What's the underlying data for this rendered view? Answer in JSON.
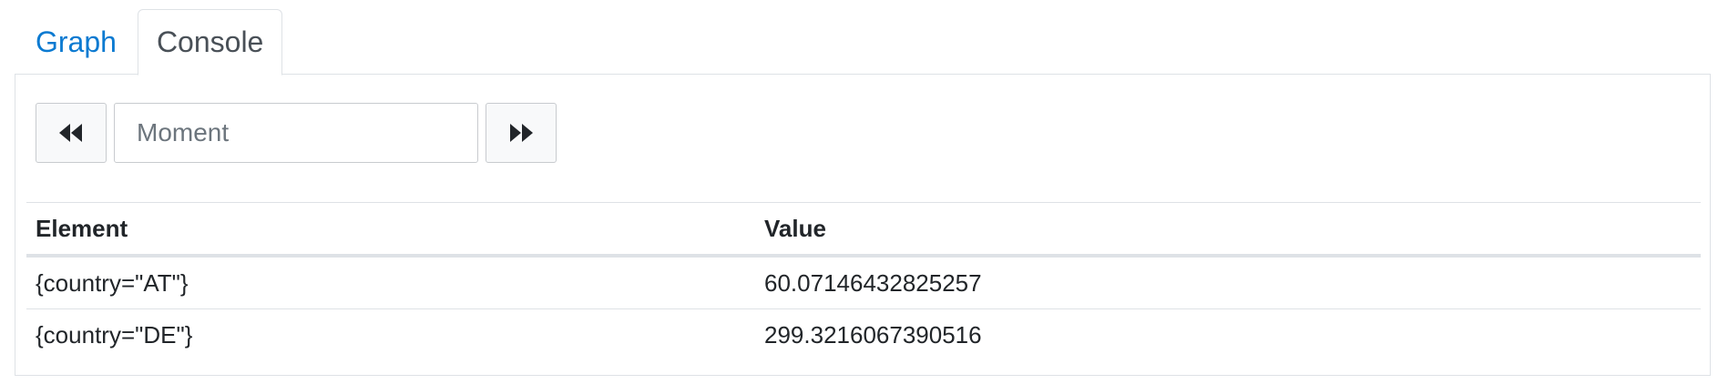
{
  "tabs": [
    {
      "label": "Graph",
      "active": false
    },
    {
      "label": "Console",
      "active": true
    }
  ],
  "controls": {
    "prev_icon": "double-chevron-left-icon",
    "next_icon": "double-chevron-right-icon",
    "moment_placeholder": "Moment",
    "moment_value": ""
  },
  "table": {
    "headers": [
      "Element",
      "Value"
    ],
    "rows": [
      {
        "element": "{country=\"AT\"}",
        "value": "60.07146432825257"
      },
      {
        "element": "{country=\"DE\"}",
        "value": "299.3216067390516"
      }
    ]
  },
  "colors": {
    "link": "#0b7ad1",
    "active_tab_text": "#495057",
    "border": "#dee2e6",
    "button_bg": "#f8f9fa"
  }
}
